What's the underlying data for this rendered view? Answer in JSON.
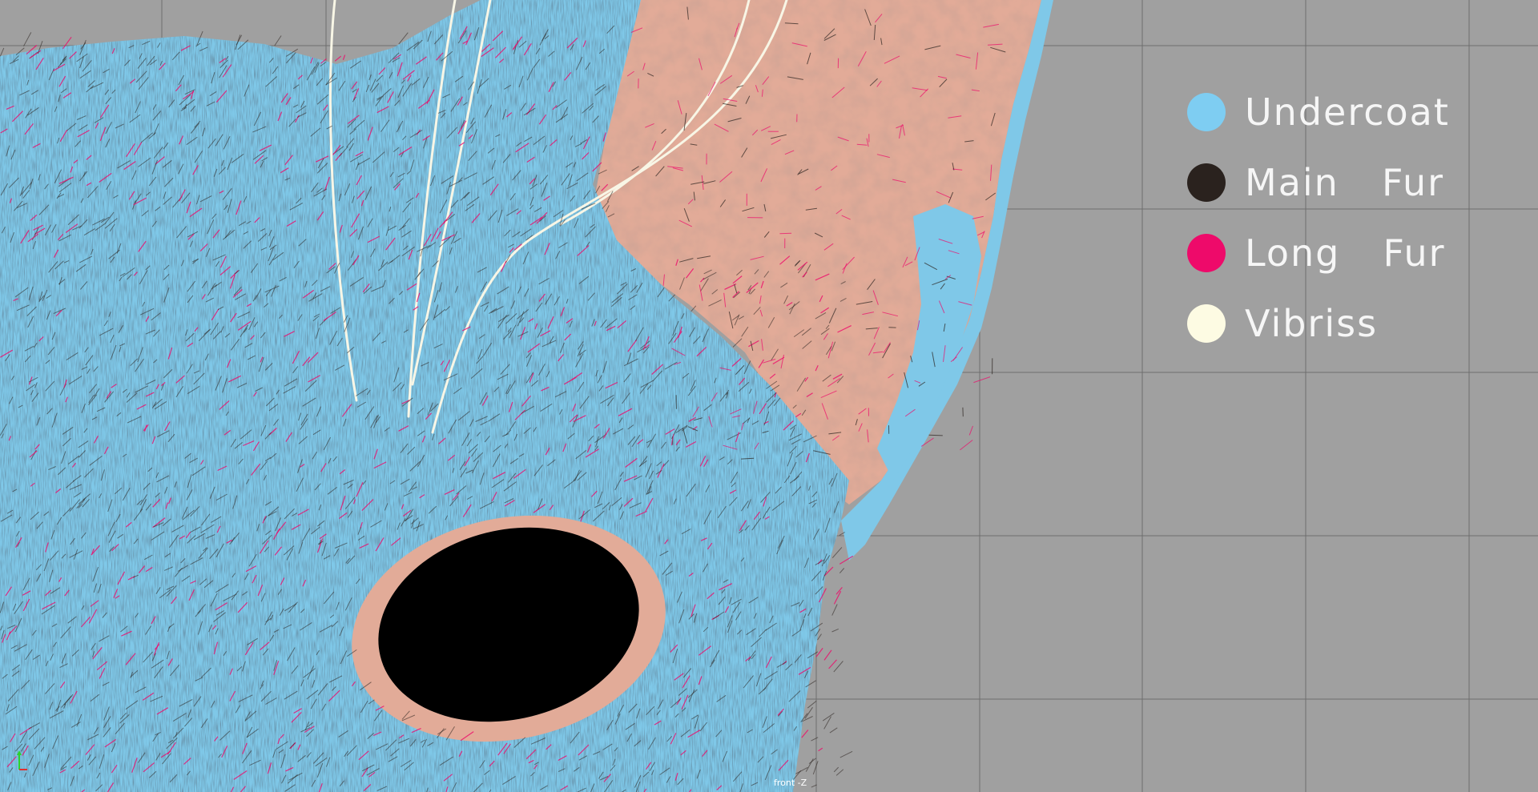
{
  "viewport": {
    "camera_label": "front -Z",
    "background_color": "#a0a0a0",
    "grid_color": "#6e6e6e"
  },
  "legend": {
    "items": [
      {
        "label": "Undercoat",
        "color": "#7ecdf2"
      },
      {
        "label": "Main  Fur",
        "color": "#2a221e"
      },
      {
        "label": "Long  Fur",
        "color": "#ee0a6a"
      },
      {
        "label": "Vibriss",
        "color": "#fdfbe3"
      }
    ]
  },
  "model": {
    "fur_color": "#7fc8e8",
    "skin_color": "#e2ab98",
    "eye_color": "#000000",
    "vibrissa_color": "#f8f6e6"
  },
  "axis": {
    "y_color": "#2bd42b",
    "x_color": "#e03030"
  }
}
